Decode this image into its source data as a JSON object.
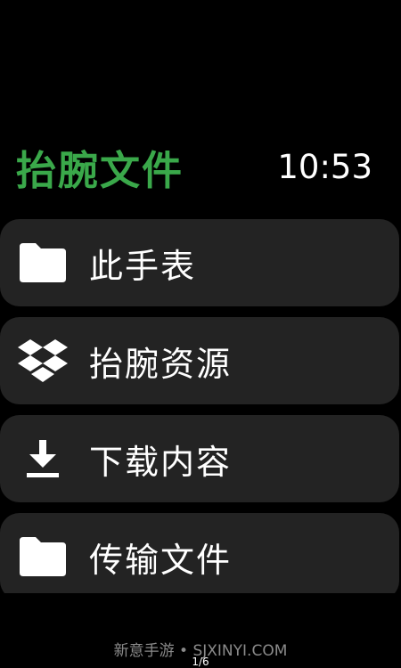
{
  "header": {
    "app_title": "抬腕文件",
    "time": "10:53"
  },
  "colors": {
    "accent": "#3aa84a",
    "item_background": "#232323",
    "background": "#000000",
    "text": "#ffffff"
  },
  "menu": {
    "items": [
      {
        "label": "此手表",
        "icon": "folder-icon"
      },
      {
        "label": "抬腕资源",
        "icon": "dropbox-icon"
      },
      {
        "label": "下载内容",
        "icon": "download-icon"
      },
      {
        "label": "传输文件",
        "icon": "folder-icon"
      }
    ]
  },
  "footer": {
    "watermark": "新意手游 • SJXINYI.COM",
    "page_indicator": "1/6"
  }
}
